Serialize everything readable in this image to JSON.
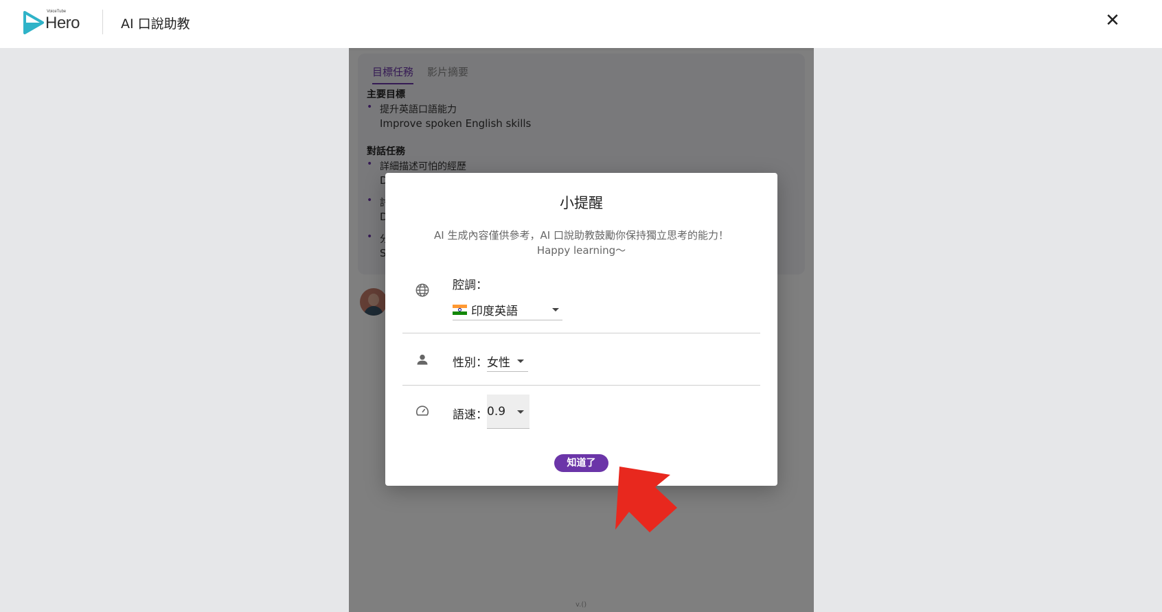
{
  "header": {
    "logo_small": "VoiceTube",
    "logo_text": "Hero",
    "title": "AI 口說助教",
    "close_label": "✕"
  },
  "task_card": {
    "tabs": [
      {
        "label": "目標任務",
        "active": true
      },
      {
        "label": "影片摘要",
        "active": false
      }
    ],
    "main_goal_title": "主要目標",
    "main_goals": [
      {
        "zh": "提升英語口語能力",
        "en": "Improve spoken English skills"
      }
    ],
    "dialog_tasks_title": "對話任務",
    "dialog_tasks": [
      {
        "zh": "詳細描述可怕的經歷",
        "en": "D"
      },
      {
        "zh": "討",
        "en": "D"
      },
      {
        "zh": "分",
        "en": "S"
      }
    ]
  },
  "version": "v.()",
  "dialog": {
    "title": "小提醒",
    "description": "AI 生成內容僅供參考，AI 口說助教鼓勵你保持獨立思考的能力！Happy learning～",
    "accent": {
      "label": "腔調：",
      "value": "印度英語",
      "icon": "globe-icon"
    },
    "gender": {
      "label": "性別：",
      "value": "女性",
      "icon": "person-icon"
    },
    "speed": {
      "label": "語速：",
      "value": "0.9",
      "icon": "speedometer-icon"
    },
    "ok_label": "知道了"
  },
  "colors": {
    "accent_purple": "#6b35a8",
    "arrow_red": "#e8281e"
  }
}
